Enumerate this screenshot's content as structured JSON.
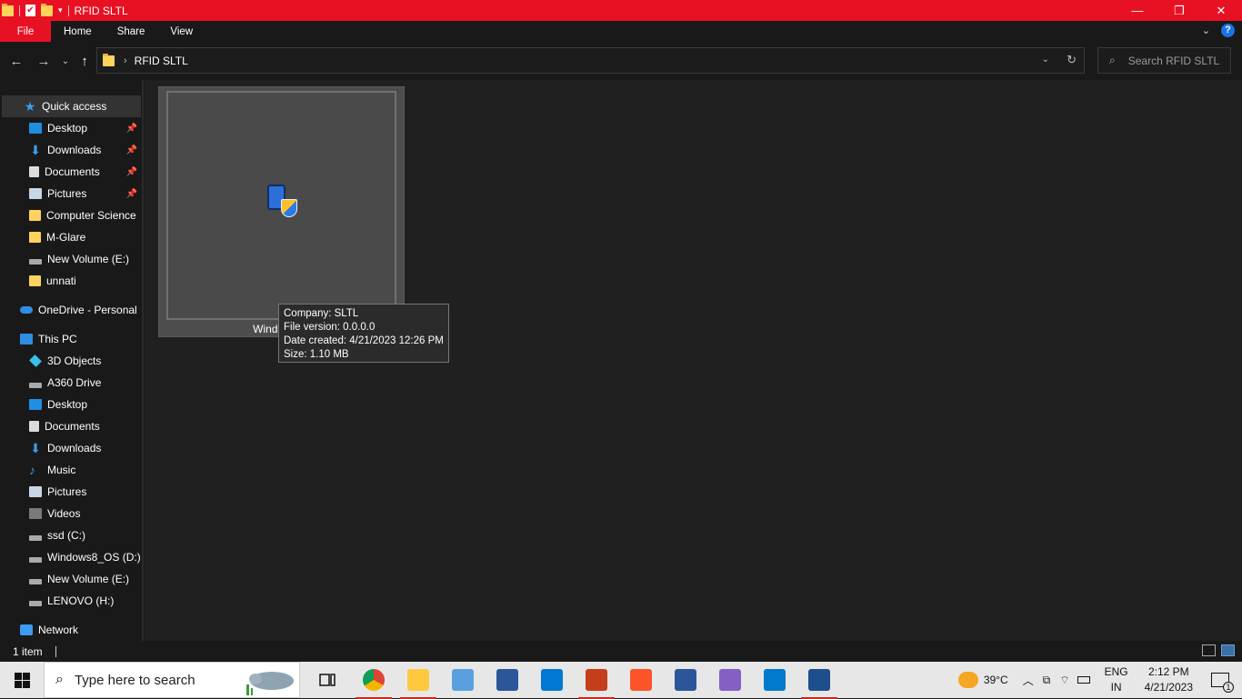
{
  "window": {
    "title": "RFID SLTL"
  },
  "ribbon": {
    "tabs": [
      "File",
      "Home",
      "Share",
      "View"
    ]
  },
  "address_bar": {
    "path": "RFID SLTL",
    "search_placeholder": "Search RFID SLTL"
  },
  "sidebar": {
    "quick_access": "Quick access",
    "quick_items": [
      {
        "label": "Desktop",
        "icon": "desktop-icon",
        "pinned": true
      },
      {
        "label": "Downloads",
        "icon": "downloads-icon",
        "pinned": true
      },
      {
        "label": "Documents",
        "icon": "documents-icon",
        "pinned": true
      },
      {
        "label": "Pictures",
        "icon": "pictures-icon",
        "pinned": true
      },
      {
        "label": "Computer Science",
        "icon": "folder-icon",
        "pinned": false
      },
      {
        "label": "M-Glare",
        "icon": "folder-icon",
        "pinned": false
      },
      {
        "label": "New Volume (E:)",
        "icon": "drive-icon",
        "pinned": false
      },
      {
        "label": "unnati",
        "icon": "folder-icon",
        "pinned": false
      }
    ],
    "onedrive": "OneDrive - Personal",
    "this_pc": "This PC",
    "pc_items": [
      {
        "label": "3D Objects",
        "icon": "3d-objects-icon"
      },
      {
        "label": "A360 Drive",
        "icon": "a360-drive-icon"
      },
      {
        "label": "Desktop",
        "icon": "desktop-icon"
      },
      {
        "label": "Documents",
        "icon": "documents-icon"
      },
      {
        "label": "Downloads",
        "icon": "downloads-icon"
      },
      {
        "label": "Music",
        "icon": "music-icon"
      },
      {
        "label": "Pictures",
        "icon": "pictures-icon"
      },
      {
        "label": "Videos",
        "icon": "videos-icon"
      },
      {
        "label": "ssd (C:)",
        "icon": "drive-icon"
      },
      {
        "label": "Windows8_OS (D:)",
        "icon": "drive-icon"
      },
      {
        "label": "New Volume (E:)",
        "icon": "drive-icon"
      },
      {
        "label": "LENOVO (H:)",
        "icon": "drive-icon"
      }
    ],
    "network": "Network"
  },
  "content": {
    "file_label": "WindowsFo",
    "tooltip": {
      "company": "Company: SLTL",
      "version": "File version: 0.0.0.0",
      "created": "Date created: 4/21/2023 12:26 PM",
      "size": "Size: 1.10 MB"
    }
  },
  "status": {
    "item_count": "1 item"
  },
  "taskbar": {
    "search_placeholder": "Type here to search",
    "weather": "39°C",
    "lang_top": "ENG",
    "lang_bottom": "IN",
    "time": "2:12 PM",
    "date": "4/21/2023",
    "notification_count": "1",
    "apps": [
      "chrome-icon",
      "file-explorer-icon",
      "laptop-icon",
      "word-icon",
      "store-icon",
      "powerpoint-icon",
      "brave-icon",
      "word-icon",
      "visual-studio-icon",
      "vscode-icon",
      "vm-app-icon"
    ]
  },
  "colors": {
    "accent_red": "#e81123",
    "sidebar_bg": "#191919",
    "content_bg": "#202020"
  }
}
